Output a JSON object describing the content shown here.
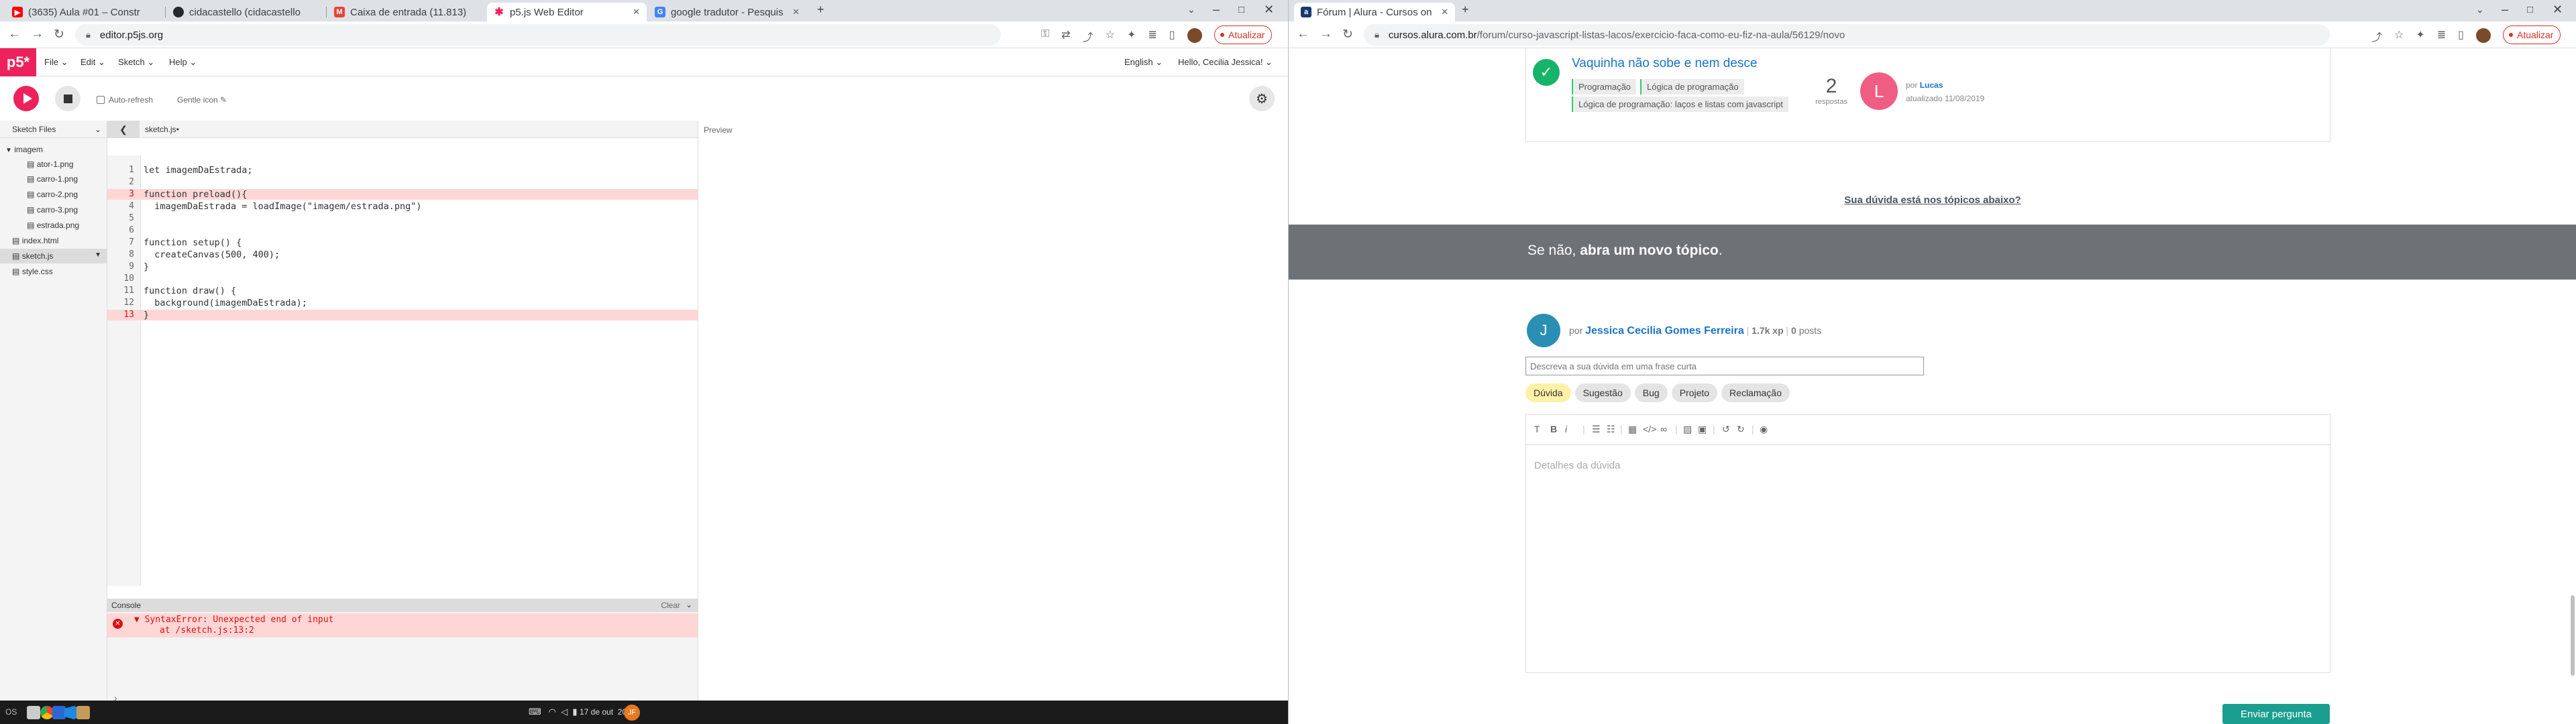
{
  "left": {
    "tabs": [
      {
        "title": "(3635) Aula #01 – Constr",
        "favColor": "#ff0000"
      },
      {
        "title": "cidacastello (cidacastello",
        "favColor": "#24292e"
      },
      {
        "title": "Caixa de entrada (11.813)",
        "favColor": "#ea4335"
      },
      {
        "title": "p5.js Web Editor",
        "favColor": "#ed225d"
      },
      {
        "title": "google tradutor - Pesquis",
        "favColor": "#4285f4"
      }
    ],
    "url": "editor.p5js.org",
    "update_label": "Atualizar",
    "p5": {
      "logo": "p5*",
      "menus": [
        "File",
        "Edit",
        "Sketch",
        "Help"
      ],
      "language": "English",
      "user": "Hello, Cecilia Jessica!",
      "auto_refresh": "Auto-refresh",
      "sketch_name": "Gentle icon",
      "sketch_files_label": "Sketch Files",
      "folder": "imagem",
      "image_files": [
        "ator-1.png",
        "carro-1.png",
        "carro-2.png",
        "carro-3.png",
        "estrada.png"
      ],
      "root_files": [
        "index.html",
        "sketch.js",
        "style.css"
      ],
      "open_file": "sketch.js",
      "preview_label": "Preview",
      "code_lines": [
        "let imagemDaEstrada;",
        "",
        "function preload(){",
        "  imagemDaEstrada = loadImage(\"imagem/estrada.png\")",
        "",
        "",
        "function setup() {",
        "  createCanvas(500, 400);",
        "}",
        "",
        "function draw() {",
        "  background(imagemDaEstrada);",
        "}"
      ],
      "error_lines": [
        3,
        13
      ],
      "console_label": "Console",
      "clear_label": "Clear",
      "error_msg": "SyntaxError: Unexpected end of input",
      "error_loc": "at /sketch.js:13:2",
      "prompt": "›"
    },
    "taskbar": {
      "os_label": "OS",
      "date": "17 de out",
      "time": "20:18",
      "user_initials": "JF"
    }
  },
  "right": {
    "tab": {
      "title": "Fórum | Alura - Cursos on",
      "favColor": "#1a3a6e"
    },
    "url_host": "cursos.alura.com.br",
    "url_path": "/forum/curso-javascript-listas-lacos/exercicio-faca-como-eu-fiz-na-aula/56129/novo",
    "update_label": "Atualizar",
    "topic": {
      "title": "Vaquinha não sobe e nem desce",
      "tags": [
        "Programação",
        "Lógica de programação",
        "Lógica de programação: laços e listas com javascript"
      ],
      "answers_count": "2",
      "answers_label": "respostas",
      "avatar_letter": "L",
      "author_prefix": "por",
      "author": "Lucas",
      "updated": "atualizado 11/08/2019"
    },
    "doubt_link": "Sua dúvida está nos tópicos abaixo?",
    "band_prefix": "Se não,",
    "band_bold": "abra um novo tópico",
    "band_suffix": ".",
    "poster": {
      "avatar_letter": "J",
      "prefix": "por",
      "name": "Jessica Cecilia Gomes Ferreira",
      "xp": "1.7k xp",
      "posts_count": "0",
      "posts_label": "posts"
    },
    "title_placeholder": "Descreva a sua dúvida em uma frase curta",
    "types": [
      "Dúvida",
      "Sugestão",
      "Bug",
      "Projeto",
      "Reclamação"
    ],
    "body_placeholder": "Detalhes da dúvida",
    "submit_label": "Enviar pergunta"
  }
}
